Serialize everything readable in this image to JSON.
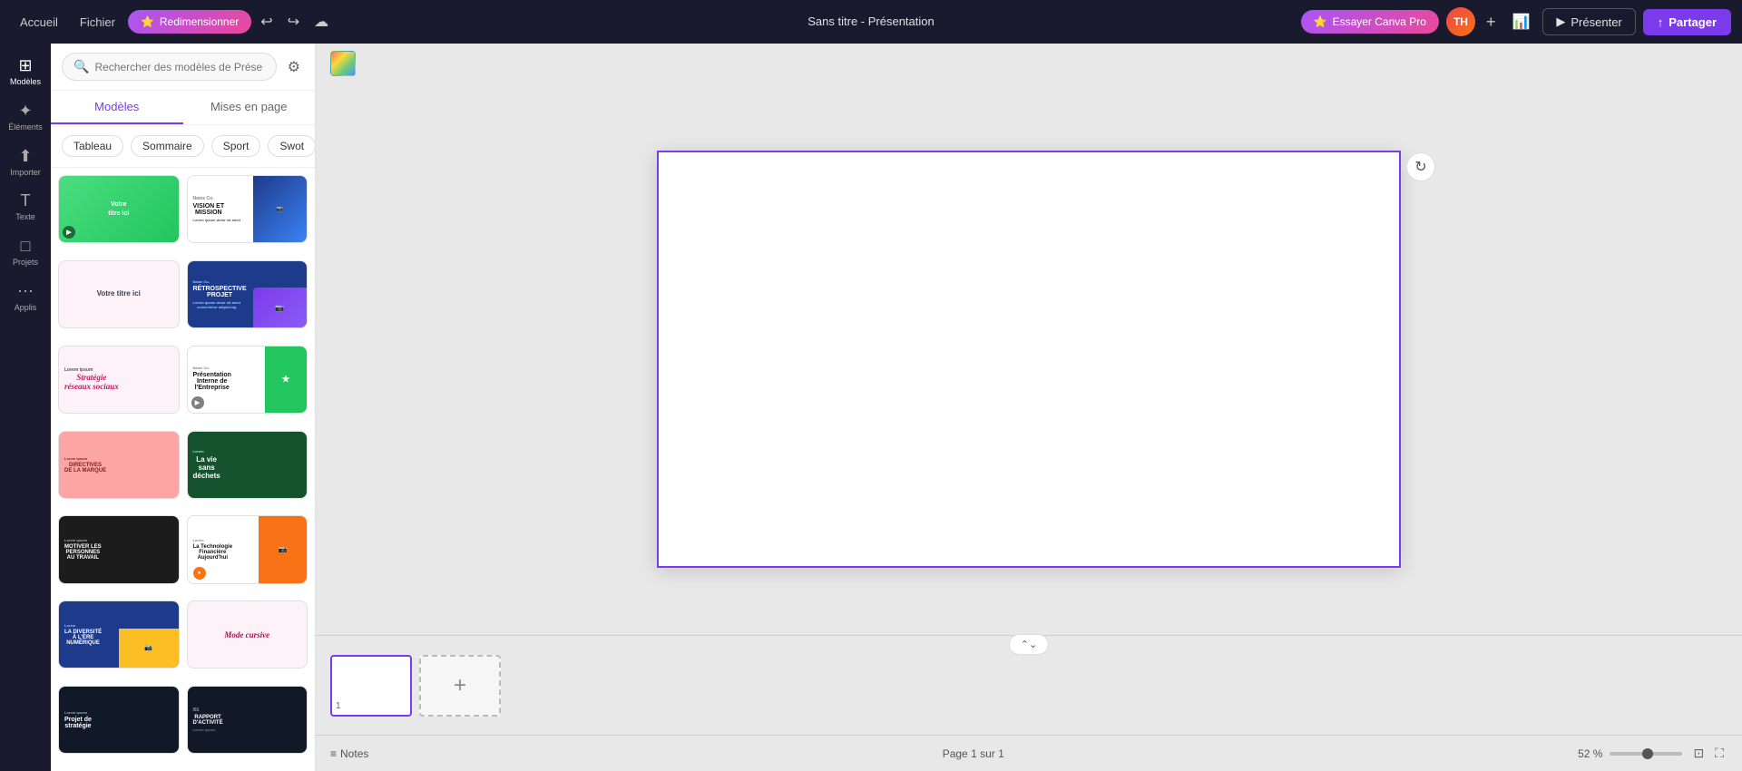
{
  "topbar": {
    "accueil_label": "Accueil",
    "fichier_label": "Fichier",
    "redimensionner_label": "Redimensionner",
    "title": "Sans titre - Présentation",
    "try_pro_label": "Essayer Canva Pro",
    "avatar_initials": "TH",
    "presenter_label": "Présenter",
    "share_label": "Partager"
  },
  "sidebar": {
    "items": [
      {
        "label": "Modèles",
        "icon": "⊞"
      },
      {
        "label": "Éléments",
        "icon": "✦"
      },
      {
        "label": "Importer",
        "icon": "↑"
      },
      {
        "label": "Texte",
        "icon": "T"
      },
      {
        "label": "Projets",
        "icon": "□"
      },
      {
        "label": "Applis",
        "icon": "⋯"
      }
    ]
  },
  "panel": {
    "search_placeholder": "Rechercher des modèles de Prése",
    "tab_modeles": "Modèles",
    "tab_mises_en_page": "Mises en page",
    "filter_chips": [
      "Tableau",
      "Sommaire",
      "Sport",
      "Swot"
    ],
    "templates": [
      {
        "id": 1,
        "title": "Votre titre ici",
        "bg": "green",
        "has_play": true
      },
      {
        "id": 2,
        "title": "VISION ET MISSION",
        "bg": "blue_white",
        "has_play": false
      },
      {
        "id": 3,
        "title": "Votre titre ici",
        "bg": "pink_light",
        "has_play": false
      },
      {
        "id": 4,
        "title": "RÉTROSPECTIVE PROJET",
        "bg": "navy_blue",
        "has_play": false
      },
      {
        "id": 5,
        "title": "Stratégie réseaux sociaux",
        "bg": "pink_cursive",
        "has_play": false
      },
      {
        "id": 6,
        "title": "Présentation Interne de l'Entreprise",
        "bg": "white_green",
        "has_play": true
      },
      {
        "id": 7,
        "title": "DIRECTIVES DE LA MARQUE",
        "bg": "peach",
        "has_play": false
      },
      {
        "id": 8,
        "title": "La vie sans déchets",
        "bg": "dark_green",
        "has_play": false
      },
      {
        "id": 9,
        "title": "MOTIVER LES PERSONNES AU TRAVAIL",
        "bg": "dark_laptop",
        "has_play": false
      },
      {
        "id": 10,
        "title": "La Technologie Financière Aujourd'hui",
        "bg": "yellow_orange",
        "has_play": false
      },
      {
        "id": 11,
        "title": "LA DIVERSITÉ À L'ÈRE NUMÉRIQUE",
        "bg": "blue_yellow",
        "has_play": false
      },
      {
        "id": 12,
        "title": "Mode cursive",
        "bg": "light_pink_cursive",
        "has_play": false
      },
      {
        "id": 13,
        "title": "Projet de stratégie",
        "bg": "dark_strategy",
        "has_play": false
      },
      {
        "id": 14,
        "title": "RAPPORT D'ACTIVITÉ /01",
        "bg": "dark_rapport",
        "has_play": false
      }
    ]
  },
  "canvas": {
    "color_swatch_label": "Couleur"
  },
  "bottom_bar": {
    "notes_label": "Notes",
    "page_label": "Page 1 sur 1",
    "zoom_level": "52 %"
  },
  "filmstrip": {
    "slide_number": "1",
    "add_slide_label": "+"
  }
}
